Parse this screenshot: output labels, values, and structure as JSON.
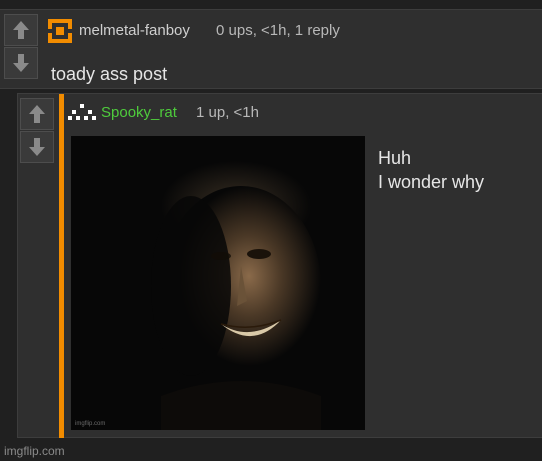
{
  "top_comment": {
    "username": "melmetal-fanboy",
    "meta": "0 ups, <1h, 1 reply",
    "text": "toady ass post",
    "avatar_icon": "orange-square-icon",
    "accent": "#f28c00"
  },
  "reply_comment": {
    "username": "Spooky_rat",
    "meta": "1 up, <1h",
    "text_line1": "Huh",
    "text_line2": "I wonder why",
    "avatar_icon": "ghost-pixel-icon",
    "username_color": "#4ecb3c",
    "image_watermark": "imgflip.com"
  },
  "footer": {
    "watermark": "imgflip.com"
  }
}
